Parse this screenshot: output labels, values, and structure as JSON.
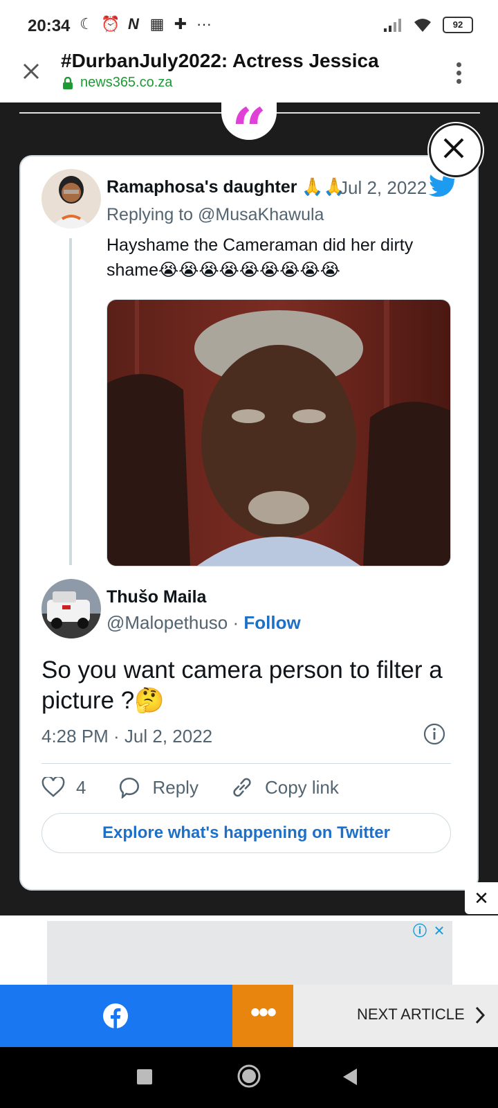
{
  "status_bar": {
    "time": "20:34",
    "battery": "92",
    "icons": [
      "moon-icon",
      "alarm-icon",
      "n-app-icon",
      "grid-app-icon",
      "bible-app-icon",
      "more-dots-icon",
      "signal-icon",
      "wifi-icon",
      "battery-icon"
    ],
    "overflow": "···"
  },
  "browser": {
    "title": "#DurbanJuly2022: Actress Jessica",
    "domain": "news365.co.za"
  },
  "quote_mark": "“",
  "tweet_parent": {
    "author": "Ramaphosa's daughter",
    "author_emoji": "🙏🙏",
    "date": "Jul 2, 2022",
    "replying_to": "Replying to @MusaKhawula",
    "text": "Hayshame the Cameraman did her dirty shame😭😭😭😭😭😭😭😭😭"
  },
  "tweet_main": {
    "author": "Thušo Maila",
    "handle": "@Malopethuso",
    "separator": " · ",
    "follow": "Follow",
    "text": "So you want camera person to filter a picture ?🤔",
    "timestamp": "4:28 PM · Jul 2, 2022",
    "likes": "4",
    "reply_label": "Reply",
    "copy_link_label": "Copy link",
    "explore_label": "Explore what's happening on Twitter"
  },
  "small_close": "✕",
  "ad": {
    "info": "ⓘ",
    "close": "✕"
  },
  "share_bar": {
    "more": "•••",
    "next_label": "NEXT ARTICLE"
  },
  "colors": {
    "link_blue": "#1d70c9",
    "twitter_blue": "#1d9bf0",
    "facebook_blue": "#1a77f2",
    "orange": "#e8850f",
    "quote_pink": "#e03fd8",
    "secure_green": "#1e9a35"
  }
}
